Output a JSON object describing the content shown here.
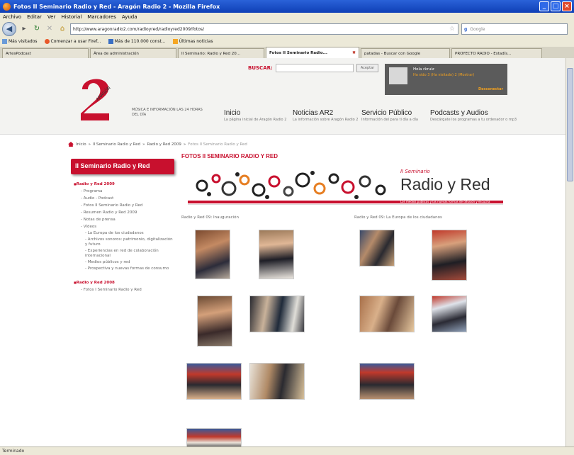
{
  "browser": {
    "window_title": "Fotos II Seminario Radio y Red - Aragón Radio 2 - Mozilla Firefox",
    "menu": [
      "Archivo",
      "Editar",
      "Ver",
      "Historial",
      "Marcadores",
      "Ayuda"
    ],
    "url": "http://www.aragonradio2.com/radioyred/radioyred2009/fotos/",
    "search_placeholder": "Google",
    "bookmarks": [
      "Más visitados",
      "Comenzar a usar Firef...",
      "Más de 110.000 const...",
      "Últimas noticias"
    ],
    "tabs": [
      {
        "label": "ArtesPodcast",
        "active": false
      },
      {
        "label": "Área de administración",
        "active": false
      },
      {
        "label": "II Seminario: Radio y Red 20...",
        "active": false
      },
      {
        "label": "Fotos II Seminario Radio...",
        "active": true
      },
      {
        "label": "patadas - Buscar con Google",
        "active": false
      },
      {
        "label": "PROYECTO RADIO - Estadís...",
        "active": false
      }
    ],
    "status": "Terminado"
  },
  "site": {
    "tagline": "MÚSICA E INFORMACIÓN LAS 24 HORAS DEL DÍA",
    "search_label": "BUSCAR:",
    "search_button": "Aceptar",
    "user": {
      "greeting": "Hola rkruiz",
      "info": "Ha sido 3 (Ha visitado) 2 (Mostrar)",
      "logout": "Desconectar"
    },
    "nav": [
      {
        "title": "Inicio",
        "sub": "La página inicial de Aragón Radio 2"
      },
      {
        "title": "Noticias AR2",
        "sub": "La información sobre Aragón Radio 2"
      },
      {
        "title": "Servicio Público",
        "sub": "Información del para ti día a día"
      },
      {
        "title": "Podcasts y Audios",
        "sub": "Descárgate los programas a tu ordenador o mp3"
      }
    ],
    "breadcrumb": [
      "Inicio",
      "II Seminario Radio y Red",
      "Radio y Red 2009",
      "Fotos II Seminario Radio y Red"
    ]
  },
  "sidebar": {
    "title": "II Seminario Radio y Red",
    "groups": [
      {
        "label": "Radio y Red 2009",
        "items": [
          {
            "label": "Programa",
            "level": 2
          },
          {
            "label": "Audio - Podcast",
            "level": 2
          },
          {
            "label": "Fotos II Seminario Radio y Red",
            "level": 2
          },
          {
            "label": "Resumen Radio y Red 2009",
            "level": 2
          },
          {
            "label": "Notas de prensa",
            "level": 2
          },
          {
            "label": "Vídeos",
            "level": 2
          },
          {
            "label": "La Europa de los ciudadanos",
            "level": 3
          },
          {
            "label": "Archivos sonoros: patrimonio, digitalización y futuro",
            "level": 3
          },
          {
            "label": "Experiencias en red de colaboración internacional",
            "level": 3
          },
          {
            "label": "Medios públicos y red",
            "level": 3
          },
          {
            "label": "Prospectiva y nuevas formas de consumo",
            "level": 3
          }
        ]
      },
      {
        "label": "Radio y Red 2008",
        "items": [
          {
            "label": "Fotos I Seminario Radio y Red",
            "level": 2
          }
        ]
      }
    ]
  },
  "main": {
    "title": "FOTOS II SEMINARIO RADIO Y RED",
    "banner": {
      "small": "II Seminario",
      "big": "Radio y Red",
      "sub": "Los medios públicos y las nuevas formas de difusión y escucha"
    },
    "gallery_left_heading": "Radio y Red 09: Inauguración",
    "gallery_right_heading": "Radio y Red 09: La Europa de los ciudadanos"
  },
  "colors": {
    "brand_red": "#c8102e",
    "header_bg": "#f3f3f1"
  }
}
